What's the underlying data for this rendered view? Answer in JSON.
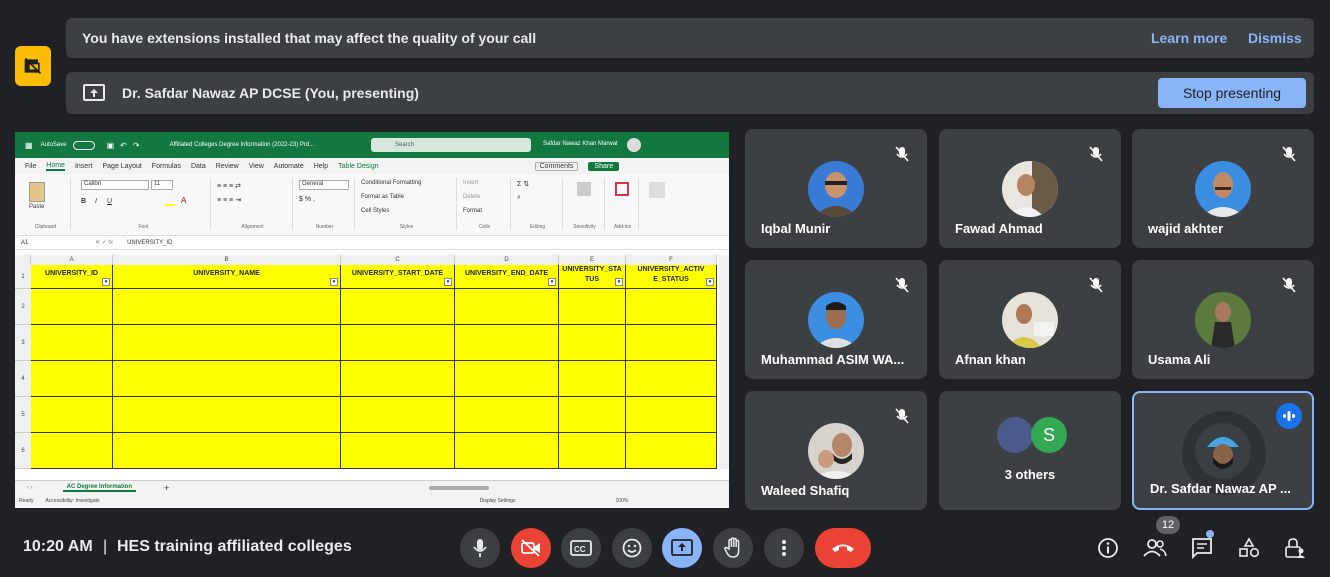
{
  "banners": {
    "extensions_text": "You have extensions installed that may affect the quality of your call",
    "learn_more": "Learn more",
    "dismiss": "Dismiss",
    "presenting_text": "Dr. Safdar Nawaz AP DCSE (You, presenting)",
    "stop_presenting": "Stop presenting"
  },
  "excel": {
    "autosave": "AutoSave",
    "file_title": "Affiliated Colleges Degree Information (2022-23) Prd...",
    "search_placeholder": "Search",
    "user": "Safdar Nawaz Khan Marwat",
    "menu": [
      "File",
      "Home",
      "Insert",
      "Page Layout",
      "Formulas",
      "Data",
      "Review",
      "View",
      "Automate",
      "Help",
      "Table Design"
    ],
    "comments": "Comments",
    "share": "Share",
    "font_name": "Calibri",
    "font_size": "11",
    "number_format": "General",
    "ribbon_groups": [
      "Clipboard",
      "Font",
      "Alignment",
      "Number",
      "Styles",
      "Cells",
      "Editing",
      "Sensitivity",
      "Add-ins"
    ],
    "styles_items": [
      "Conditional Formatting",
      "Format as Table",
      "Cell Styles"
    ],
    "cells_items": [
      "Insert",
      "Delete",
      "Format"
    ],
    "name_box": "A1",
    "formula_value": "UNIVERSITY_ID",
    "columns": [
      "A",
      "B",
      "C",
      "D",
      "E",
      "F"
    ],
    "headers": [
      "UNIVERSITY_ID",
      "UNIVERSITY_NAME",
      "UNIVERSITY_START_DATE",
      "UNIVERSITY_END_DATE",
      "UNIVERSITY_STATUS",
      "UNIVERSITY_ACTIVE_STATUS"
    ],
    "headers_display": [
      "UNIVERSITY_ID",
      "UNIVERSITY_NAME",
      "UNIVERSITY_START_DATE",
      "UNIVERSITY_END_DATE",
      "UNIVERSITY_STA TUS",
      "UNIVERSITY_ACTIV E_STATUS"
    ],
    "rows": [
      "1",
      "2",
      "3",
      "4",
      "5",
      "6"
    ],
    "sheet_tab": "AC Degree Information",
    "status_ready": "Ready",
    "status_accessibility": "Accessibility: Investigate",
    "display_settings": "Display Settings",
    "zoom": "100%"
  },
  "participants": [
    {
      "name": "Iqbal Munir",
      "muted": true
    },
    {
      "name": "Fawad Ahmad",
      "muted": true
    },
    {
      "name": "wajid akhter",
      "muted": true
    },
    {
      "name": "Muhammad ASIM WA...",
      "muted": true
    },
    {
      "name": "Afnan khan",
      "muted": true
    },
    {
      "name": "Usama Ali",
      "muted": true
    },
    {
      "name": "Waleed Shafiq",
      "muted": true
    },
    {
      "name": "3 others",
      "initial": "S"
    },
    {
      "name": "Dr. Safdar Nawaz AP ...",
      "speaking": true
    }
  ],
  "bottom": {
    "time": "10:20 AM",
    "separator": "|",
    "meeting_name": "HES training affiliated colleges",
    "people_count": "12"
  },
  "colors": {
    "bg": "#202124",
    "tile": "#3c4043",
    "accent": "#8ab4f8",
    "red": "#ea4335",
    "excel_green": "#127840",
    "cell_yellow": "#ffff00"
  }
}
